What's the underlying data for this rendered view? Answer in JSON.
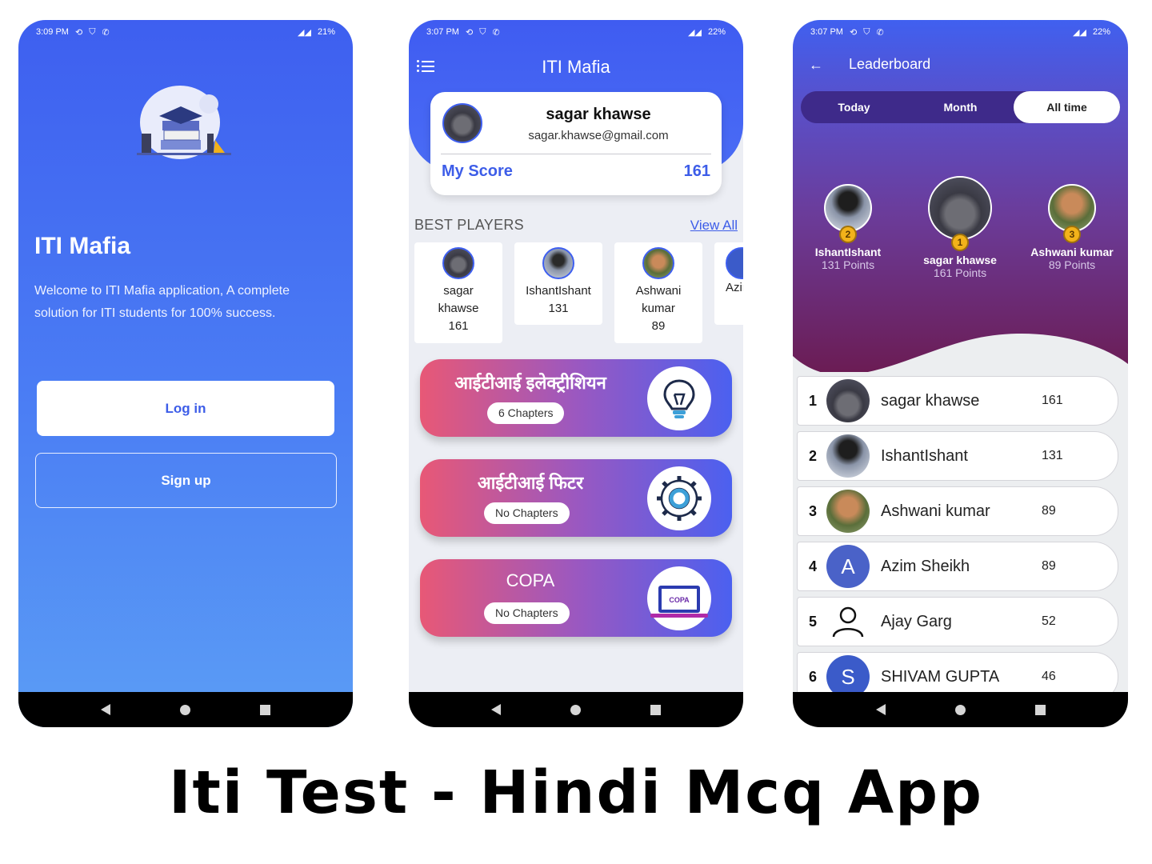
{
  "phone1": {
    "status": {
      "time": "3:09 PM",
      "battery": "21%"
    },
    "app_title": "ITI Mafia",
    "welcome_text": "Welcome to ITI Mafia application, A complete solution for ITI students for 100% success.",
    "login_label": "Log in",
    "signup_label": "Sign up"
  },
  "phone2": {
    "status": {
      "time": "3:07 PM",
      "battery": "22%"
    },
    "header_title": "ITI Mafia",
    "profile": {
      "name": "sagar khawse",
      "email": "sagar.khawse@gmail.com",
      "score_label": "My Score",
      "score": "161"
    },
    "best_players_label": "BEST PLAYERS",
    "view_all_label": "View All",
    "players": [
      {
        "name": "sagar khawse",
        "score": "161"
      },
      {
        "name": "IshantIshant",
        "score": "131"
      },
      {
        "name": "Ashwani kumar",
        "score": "89"
      },
      {
        "name": "Azir",
        "score": ""
      }
    ],
    "courses": [
      {
        "title": "आईटीआई इलेक्ट्रीशियन",
        "chapters": "6 Chapters",
        "icon": "lightbulb-icon"
      },
      {
        "title": "आईटीआई फिटर",
        "chapters": "No Chapters",
        "icon": "gear-icon"
      },
      {
        "title": "COPA",
        "chapters": "No Chapters",
        "icon": "laptop-icon",
        "icon_label": "COPA"
      }
    ]
  },
  "phone3": {
    "status": {
      "time": "3:07 PM",
      "battery": "22%"
    },
    "title": "Leaderboard",
    "tabs": [
      {
        "label": "Today",
        "active": false
      },
      {
        "label": "Month",
        "active": false
      },
      {
        "label": "All time",
        "active": true
      }
    ],
    "podium": [
      {
        "name": "IshantIshant",
        "points": "131 Points",
        "medal": "2"
      },
      {
        "name": "sagar khawse",
        "points": "161 Points",
        "medal": "1"
      },
      {
        "name": "Ashwani kumar",
        "points": "89 Points",
        "medal": "3"
      }
    ],
    "rows": [
      {
        "rank": "1",
        "name": "sagar khawse",
        "points": "161",
        "avatar": "photo"
      },
      {
        "rank": "2",
        "name": "IshantIshant",
        "points": "131",
        "avatar": "photo"
      },
      {
        "rank": "3",
        "name": "Ashwani kumar",
        "points": "89",
        "avatar": "photo"
      },
      {
        "rank": "4",
        "name": "Azim Sheikh",
        "points": "89",
        "avatar": "A"
      },
      {
        "rank": "5",
        "name": "Ajay Garg",
        "points": "52",
        "avatar": "person-icon"
      },
      {
        "rank": "6",
        "name": "SHIVAM GUPTA",
        "points": "46",
        "avatar": "S"
      }
    ]
  },
  "footer_title": "Iti Test - Hindi Mcq App",
  "colors": {
    "primary_blue": "#3e5ff0",
    "gradient_pink": "#e85876",
    "leader_purple": "#6b1c54",
    "avatar_blue": "#3b5bc9"
  }
}
